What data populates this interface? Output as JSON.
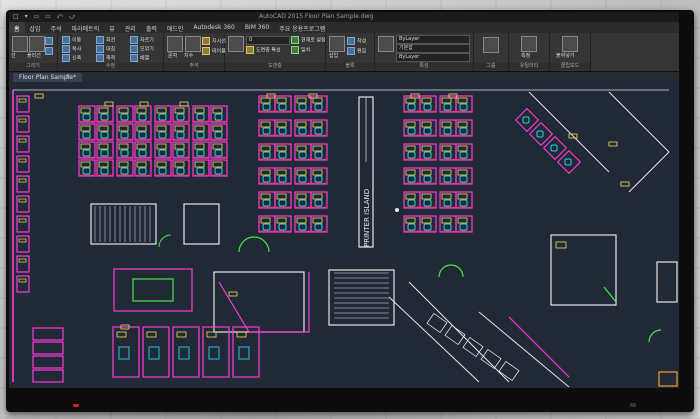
{
  "window": {
    "title": "AutoCAD 2015  Floor Plan Sample.dwg",
    "quick_access": "□ ▾ ▭ ▭ ⤺ ⤻"
  },
  "ribbon_tabs": [
    "홈",
    "삽입",
    "주석",
    "파라메트릭",
    "뷰",
    "관리",
    "출력",
    "애드인",
    "Autodesk 360",
    "BIM 360",
    "주요 응용프로그램"
  ],
  "ribbon": {
    "draw": {
      "label": "그리기",
      "line": "선",
      "polyline": "폴리선",
      "circle": "원",
      "arc": "호"
    },
    "modify": {
      "label": "수정",
      "items": [
        "이동",
        "회전",
        "자르기",
        "복사",
        "대칭",
        "모깎기",
        "신축",
        "축척",
        "배열"
      ]
    },
    "annotation": {
      "label": "주석",
      "text": "문자",
      "dimension": "치수",
      "leader": "지시선",
      "table": "테이블"
    },
    "layers": {
      "label": "도면층",
      "items": [
        "도면층 특성",
        "현재로 설정",
        "일치"
      ],
      "combo": "0"
    },
    "block": {
      "label": "블록",
      "insert": "삽입",
      "create": "작성",
      "edit": "편집"
    },
    "properties": {
      "label": "특성",
      "bylayer_1": "ByLayer",
      "bylayer_2": "기본값",
      "bylayer_3": "ByLayer"
    },
    "groups": {
      "label": "그룹"
    },
    "utilities": {
      "label": "유틸리티",
      "measure": "측정"
    },
    "clipboard": {
      "label": "클립보드",
      "paste": "붙여넣기"
    }
  },
  "document_tab": {
    "label": "Floor Plan Sample*",
    "add": "+"
  },
  "drawing": {
    "printer_island": "PRINTER ISLAND"
  },
  "colors": {
    "pink": "#ff3bd7",
    "cyan": "#22d8e8",
    "yellow": "#f0e05a",
    "red": "#ff4040",
    "green": "#43e84a",
    "white": "#e6e6e6",
    "orange": "#f0a030"
  }
}
